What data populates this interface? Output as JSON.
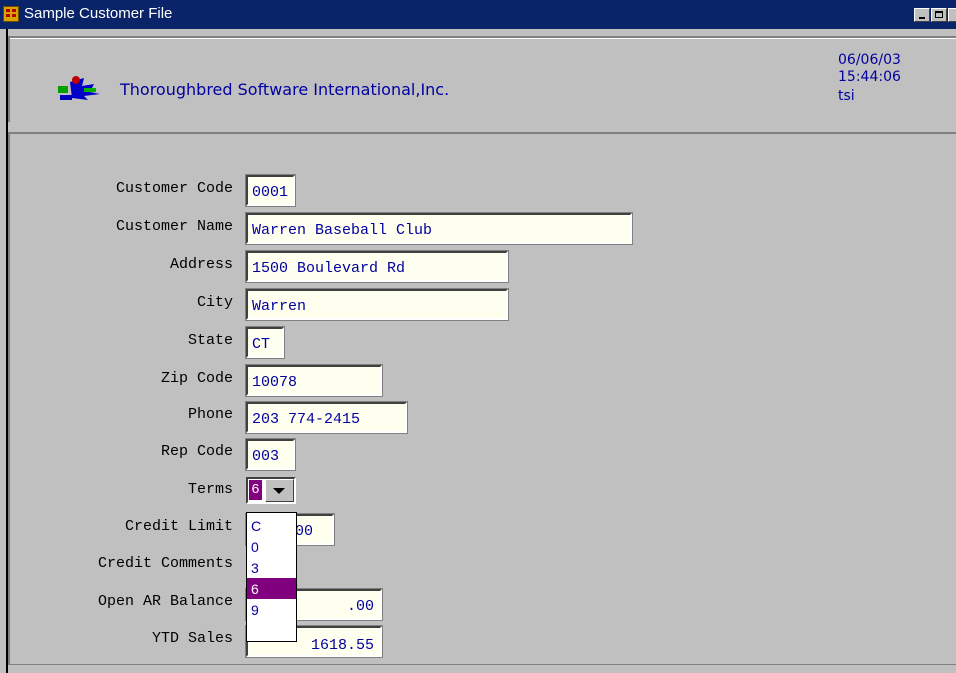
{
  "window": {
    "title": "Sample Customer File"
  },
  "header": {
    "company": "Thoroughbred Software International,Inc.",
    "date": "06/06/03",
    "time": "15:44:06",
    "user": "tsi"
  },
  "form": {
    "customer_code": {
      "label": "Customer Code",
      "value": "0001"
    },
    "customer_name": {
      "label": "Customer Name",
      "value": "Warren Baseball Club"
    },
    "address": {
      "label": "Address",
      "value": "1500 Boulevard Rd"
    },
    "city": {
      "label": "City",
      "value": "Warren"
    },
    "state": {
      "label": "State",
      "value": "CT"
    },
    "zip": {
      "label": "Zip Code",
      "value": "10078"
    },
    "phone": {
      "label": "Phone",
      "value": "203 774-2415"
    },
    "rep_code": {
      "label": "Rep Code",
      "value": "003"
    },
    "terms": {
      "label": "Terms",
      "value": "6",
      "options": [
        "C",
        "0",
        "3",
        "6",
        "9"
      ],
      "selected_index": 3
    },
    "credit_limit": {
      "label": "Credit Limit",
      "value_visible": "00"
    },
    "credit_comments": {
      "label": "Credit Comments"
    },
    "open_ar_balance": {
      "label": "Open AR Balance",
      "value": ".00"
    },
    "ytd_sales": {
      "label": "YTD Sales",
      "value_visible": "1618.55"
    }
  },
  "colors": {
    "title_bar": "#0a246a",
    "field_background": "#fffff0",
    "field_text": "#0000a0",
    "selection": "#800080"
  },
  "icons": [
    "app-grid-icon",
    "minimize-icon",
    "maximize-icon",
    "close-icon",
    "company-logo",
    "dropdown-arrow-icon"
  ]
}
